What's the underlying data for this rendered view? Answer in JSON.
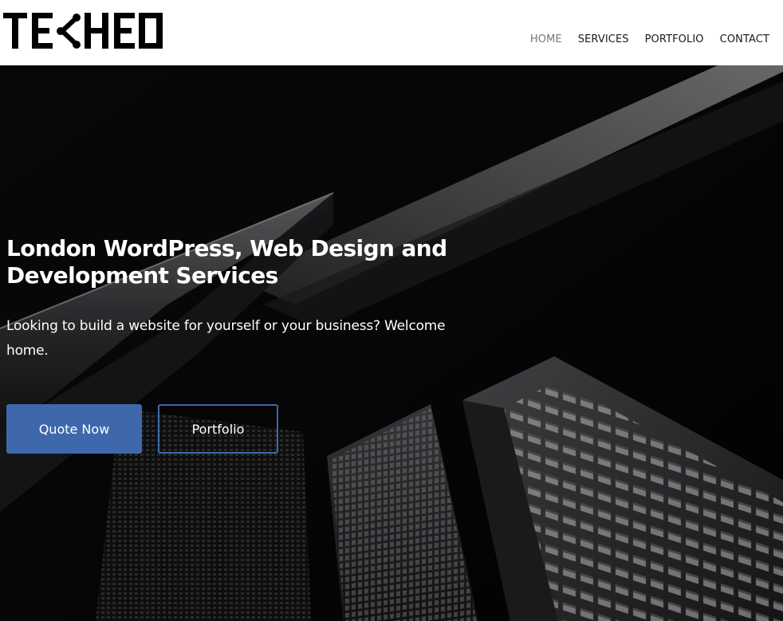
{
  "brand": {
    "logo_text": "TECHEO"
  },
  "nav": {
    "items": [
      {
        "label": "HOME",
        "active": true
      },
      {
        "label": "SERVICES",
        "active": false
      },
      {
        "label": "PORTFOLIO",
        "active": false
      },
      {
        "label": "CONTACT",
        "active": false
      }
    ]
  },
  "hero": {
    "title": "London WordPress, Web Design and Development Services",
    "subtitle": "Looking to build a website for yourself or your business? Welcome home.",
    "primary_button": "Quote Now",
    "secondary_button": "Portfolio"
  },
  "colors": {
    "accent": "#3f68ac",
    "hero_background": "#050507",
    "nav_active": "#777777",
    "nav_text": "#1a1a1a"
  }
}
